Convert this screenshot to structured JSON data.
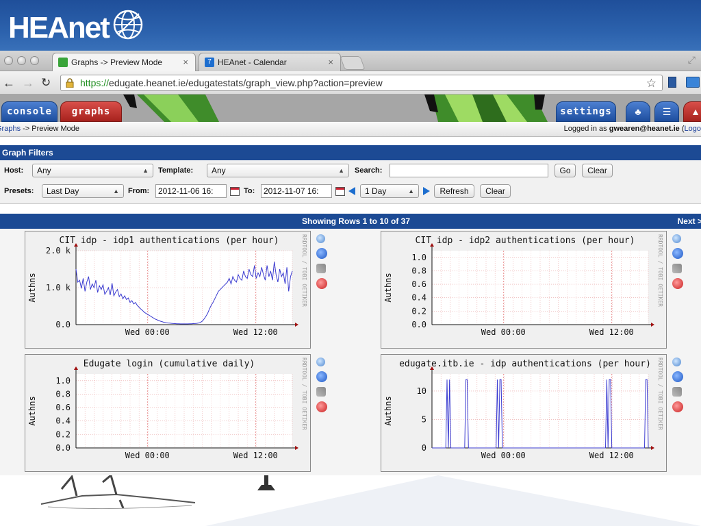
{
  "brand": {
    "logo_text": "HEAnet"
  },
  "browser": {
    "tabs": [
      {
        "label": "Graphs -> Preview Mode",
        "active": true
      },
      {
        "label": "HEAnet - Calendar",
        "active": false
      }
    ],
    "url_scheme": "https://",
    "url_rest": "edugate.heanet.ie/edugatestats/graph_view.php?action=preview"
  },
  "app": {
    "nav": {
      "console": "console",
      "graphs": "graphs",
      "settings": "settings"
    },
    "breadcrumb": {
      "link": "Graphs",
      "sep": " -> ",
      "current": "Preview Mode"
    },
    "login": {
      "prefix": "Logged in as ",
      "user": "gwearen@heanet.ie",
      "open": " (",
      "logout": "Logo"
    },
    "filters": {
      "title": "Graph Filters",
      "host_label": "Host:",
      "host_value": "Any",
      "template_label": "Template:",
      "template_value": "Any",
      "search_label": "Search:",
      "search_value": "",
      "go_label": "Go",
      "clear1_label": "Clear",
      "presets_label": "Presets:",
      "presets_value": "Last Day",
      "from_label": "From:",
      "from_value": "2012-11-06 16:",
      "to_label": "To:",
      "to_value": "2012-11-07 16:",
      "span_value": "1 Day",
      "refresh_label": "Refresh",
      "clear2_label": "Clear"
    },
    "rows_text": "Showing Rows 1 to 10 of 37",
    "next_label": "Next >"
  },
  "colors": {
    "accent": "#1c4a94",
    "line": "#3b3bd0",
    "grid": "#e8a0a0",
    "tab_red": "#b82a25"
  },
  "chart_data": [
    {
      "type": "line",
      "title": "CIT idp - idp1 authentications (per hour)",
      "ylabel": "Authns",
      "ylim": [
        0,
        2000
      ],
      "yticks": [
        0,
        1000,
        2000
      ],
      "ytick_labels": [
        "0.0",
        "1.0 k",
        "2.0 k"
      ],
      "xtick_labels": [
        "Wed 00:00",
        "Wed 12:00"
      ],
      "side_label": "RRDTOOL / TOBI OETIKER",
      "series": [
        {
          "values": [
            1500,
            1150,
            1200,
            980,
            1250,
            900,
            1150,
            1300,
            950,
            1100,
            1000,
            1200,
            870,
            1050,
            950,
            1080,
            820,
            900,
            1000,
            800,
            1120,
            780,
            880,
            950,
            760,
            830,
            700,
            780,
            680,
            720,
            600,
            650,
            560,
            600,
            520,
            470,
            420,
            380,
            330,
            300,
            270,
            240,
            210,
            180,
            150,
            130,
            110,
            90,
            75,
            60,
            50,
            45,
            40,
            35,
            30,
            28,
            25,
            22,
            20,
            20,
            20,
            20,
            20,
            22,
            25,
            28,
            30,
            35,
            45,
            60,
            90,
            150,
            220,
            300,
            420,
            520,
            600,
            700,
            800,
            900,
            950,
            1000,
            1050,
            1100,
            1150,
            1250,
            1100,
            1300,
            1200,
            1150,
            1350,
            1250,
            1200,
            1450,
            1300,
            1250,
            1500,
            1350,
            1300,
            1600,
            1250,
            1400,
            1300,
            1550,
            1350,
            1200,
            1600,
            1300,
            1450,
            1200,
            1700,
            1350,
            1150,
            1500,
            1300,
            1400,
            1100,
            1550,
            900,
            1300,
            1450
          ]
        }
      ]
    },
    {
      "type": "line",
      "title": "CIT idp - idp2 authentications (per hour)",
      "ylabel": "Authns",
      "ylim": [
        0,
        1.1
      ],
      "yticks": [
        0,
        0.2,
        0.4,
        0.6,
        0.8,
        1.0
      ],
      "ytick_labels": [
        "0.0",
        "0.2",
        "0.4",
        "0.6",
        "0.8",
        "1.0"
      ],
      "xtick_labels": [
        "Wed 00:00",
        "Wed 12:00"
      ],
      "side_label": "RRDTOOL / TOBI OETIKER",
      "series": [
        {
          "values": []
        }
      ]
    },
    {
      "type": "line",
      "title": "Edugate login (cumulative daily)",
      "ylabel": "Authns",
      "ylim": [
        0,
        1.1
      ],
      "yticks": [
        0,
        0.2,
        0.4,
        0.6,
        0.8,
        1.0
      ],
      "ytick_labels": [
        "0.0",
        "0.2",
        "0.4",
        "0.6",
        "0.8",
        "1.0"
      ],
      "xtick_labels": [
        "Wed 00:00",
        "Wed 12:00"
      ],
      "side_label": "RRDTOOL / TOBI OETIKER",
      "series": [
        {
          "values": []
        }
      ]
    },
    {
      "type": "line",
      "title": "edugate.itb.ie - idp authentications (per hour)",
      "ylabel": "Authns",
      "ylim": [
        0,
        13
      ],
      "yticks": [
        0,
        5,
        10
      ],
      "ytick_labels": [
        "0",
        "5",
        "10"
      ],
      "xtick_labels": [
        "Wed 00:00",
        "Wed 12:00"
      ],
      "side_label": "RRDTOOL / TOBI OETIKER",
      "series": [
        {
          "values": [
            0,
            0,
            0,
            0,
            0,
            0,
            0,
            0,
            0,
            0,
            0,
            0,
            12,
            0,
            12,
            0,
            0,
            0,
            0,
            0,
            0,
            0,
            0,
            0,
            0,
            0,
            0,
            12,
            12,
            0,
            0,
            0,
            0,
            0,
            0,
            0,
            0,
            0,
            0,
            0,
            0,
            0,
            0,
            0,
            0,
            0,
            0,
            0,
            0,
            0,
            0,
            0,
            12,
            0,
            12,
            12,
            0,
            0,
            0,
            0,
            0,
            0,
            0,
            0,
            0,
            0,
            0,
            0,
            0,
            0,
            0,
            0,
            0,
            0,
            0,
            0,
            0,
            0,
            0,
            0,
            0,
            0,
            0,
            0,
            0,
            0,
            0,
            0,
            0,
            0,
            0,
            0,
            0,
            0,
            0,
            0,
            0,
            0,
            0,
            0,
            0,
            0,
            0,
            0,
            0,
            0,
            0,
            0,
            0,
            0,
            0,
            0,
            0,
            0,
            0,
            0,
            0,
            0,
            0,
            0,
            0,
            0,
            0,
            0,
            0,
            0,
            0,
            0,
            0,
            0,
            0,
            0,
            0,
            0,
            0,
            0,
            0,
            0,
            0,
            12,
            0,
            12,
            12,
            0,
            0,
            0,
            0,
            0,
            0,
            0,
            0,
            0,
            0,
            0,
            0,
            0,
            0,
            0,
            0,
            0,
            0,
            0,
            0,
            0,
            0,
            0,
            0,
            0,
            0,
            0,
            12,
            12,
            0
          ]
        }
      ]
    }
  ]
}
